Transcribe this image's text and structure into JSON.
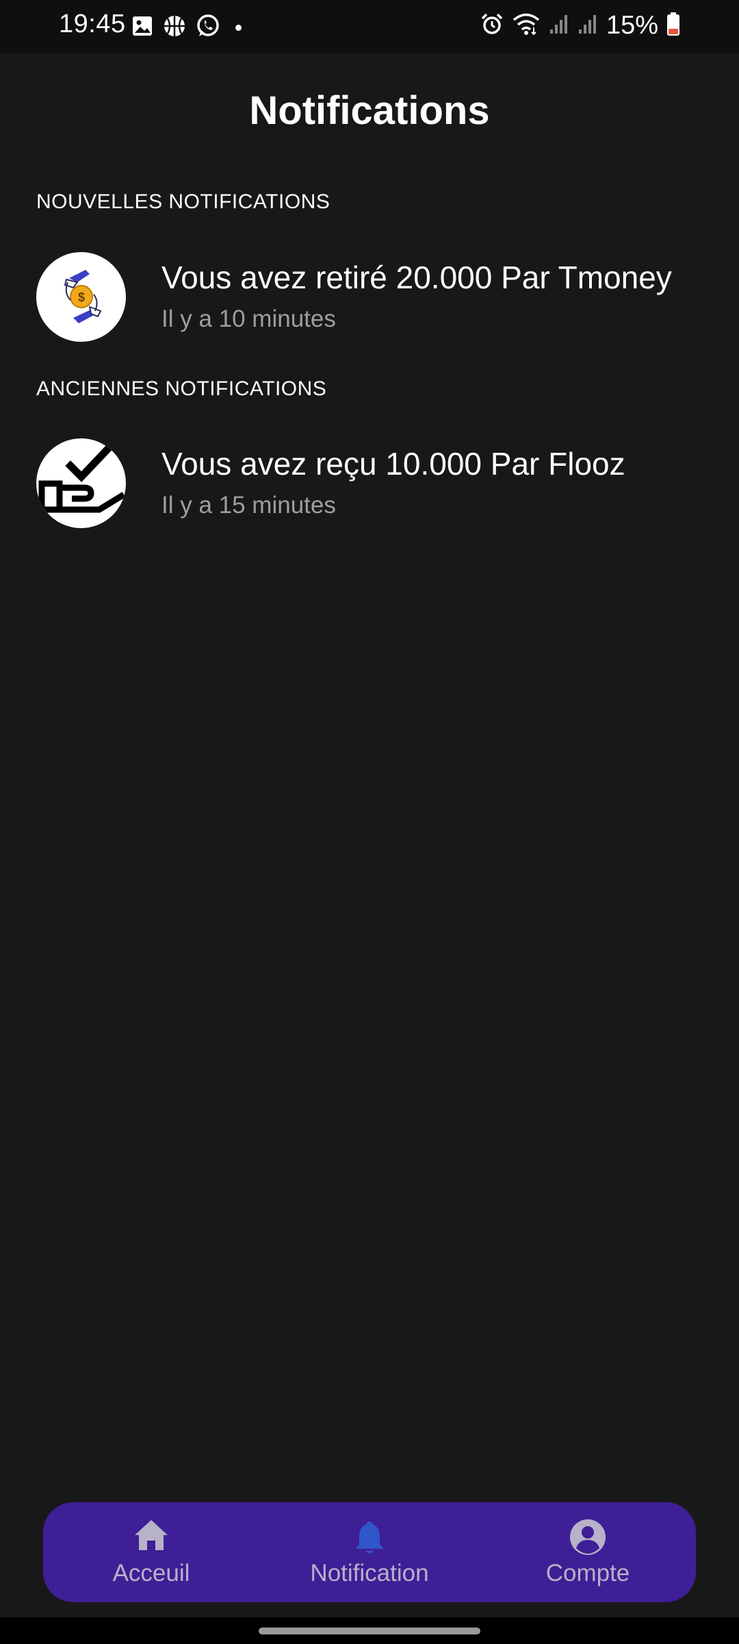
{
  "status_bar": {
    "time": "19:45",
    "battery": "15%",
    "left_icons": [
      "gallery-icon",
      "basketball-icon",
      "whatsapp-icon",
      "dot-icon"
    ],
    "right_icons": [
      "alarm-icon",
      "wifi-icon",
      "signal-icon",
      "signal-icon",
      "battery-icon"
    ],
    "battery_color": "#e8553b"
  },
  "page": {
    "title": "Notifications"
  },
  "sections": [
    {
      "header": "NOUVELLES NOTIFICATIONS",
      "items": [
        {
          "icon": "money-hands-icon",
          "title": "Vous avez retiré 20.000 Par Tmoney",
          "time": "Il y a 10 minutes"
        }
      ]
    },
    {
      "header": "ANCIENNES NOTIFICATIONS",
      "items": [
        {
          "icon": "hand-check-icon",
          "title": "Vous avez reçu 10.000 Par Flooz",
          "time": "Il y a 15 minutes"
        }
      ]
    }
  ],
  "bottom_nav": {
    "items": [
      {
        "label": "Acceuil",
        "icon": "home-icon"
      },
      {
        "label": "Notification",
        "icon": "bell-icon",
        "active": true
      },
      {
        "label": "Compte",
        "icon": "account-icon"
      }
    ],
    "background": "#3e1f96",
    "active_icon_color": "#2f57c9",
    "inactive_icon_color": "#b7b1c9"
  }
}
